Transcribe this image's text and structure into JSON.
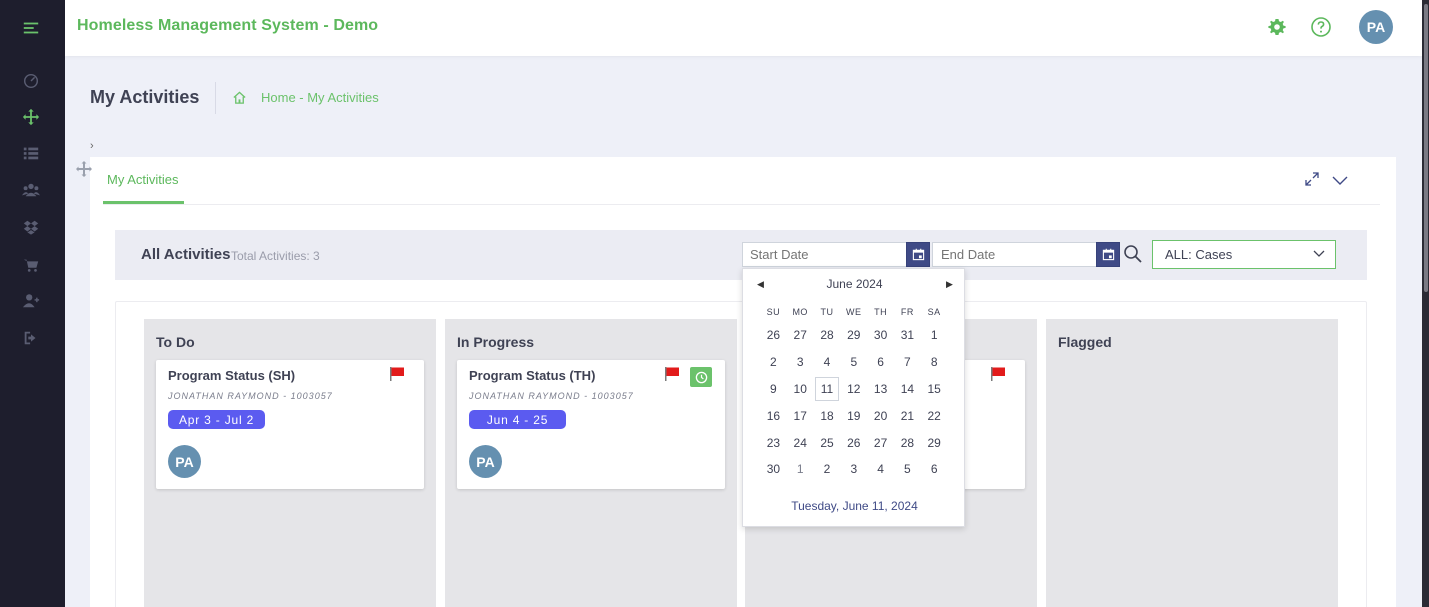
{
  "header": {
    "app_title": "Homeless Management System - Demo",
    "user_initials": "PA"
  },
  "sidebar": {
    "items": [
      {
        "icon": "menu-icon"
      },
      {
        "icon": "dashboard-icon"
      },
      {
        "icon": "crosshair-move-icon",
        "active": true
      },
      {
        "icon": "list-icon"
      },
      {
        "icon": "users-group-icon"
      },
      {
        "icon": "dropbox-icon"
      },
      {
        "icon": "cart-icon"
      },
      {
        "icon": "add-user-icon"
      },
      {
        "icon": "sign-out-icon"
      }
    ]
  },
  "subheader": {
    "page_title": "My Activities",
    "breadcrumb": "Home - My Activities"
  },
  "card": {
    "tab_label": "My Activities"
  },
  "filter": {
    "heading": "All Activities",
    "total": "Total Activities: 3",
    "start_placeholder": "Start Date",
    "end_placeholder": "End Date",
    "case_select": "ALL: Cases"
  },
  "board": {
    "columns": [
      {
        "title": "To Do"
      },
      {
        "title": "In Progress"
      },
      {
        "title": ""
      },
      {
        "title": "Flagged"
      }
    ],
    "cards": [
      {
        "title": "Program Status (SH)",
        "client": "JONATHAN RAYMOND - 1003057",
        "dates": "Apr 3 - Jul 2",
        "initials": "PA"
      },
      {
        "title": "Program Status (TH)",
        "client": "JONATHAN RAYMOND - 1003057",
        "dates": "Jun 4 - 25",
        "initials": "PA"
      }
    ]
  },
  "datepicker": {
    "month_label": "June 2024",
    "weekdays": [
      "SU",
      "MO",
      "TU",
      "WE",
      "TH",
      "FR",
      "SA"
    ],
    "weeks": [
      [
        "26",
        "27",
        "28",
        "29",
        "30",
        "31",
        "1"
      ],
      [
        "2",
        "3",
        "4",
        "5",
        "6",
        "7",
        "8"
      ],
      [
        "9",
        "10",
        "11",
        "12",
        "13",
        "14",
        "15"
      ],
      [
        "16",
        "17",
        "18",
        "19",
        "20",
        "21",
        "22"
      ],
      [
        "23",
        "24",
        "25",
        "26",
        "27",
        "28",
        "29"
      ],
      [
        "30",
        "1",
        "2",
        "3",
        "4",
        "5",
        "6"
      ]
    ],
    "today_label": "Tuesday, June 11, 2024"
  },
  "colors": {
    "brand_green": "#5cb85c",
    "sidebar_bg": "#1e1e2d",
    "date_button": "#3f4a86",
    "date_badge": "#5b5bf0",
    "avatar": "#6590b0",
    "flag_red": "#e21b1b"
  }
}
